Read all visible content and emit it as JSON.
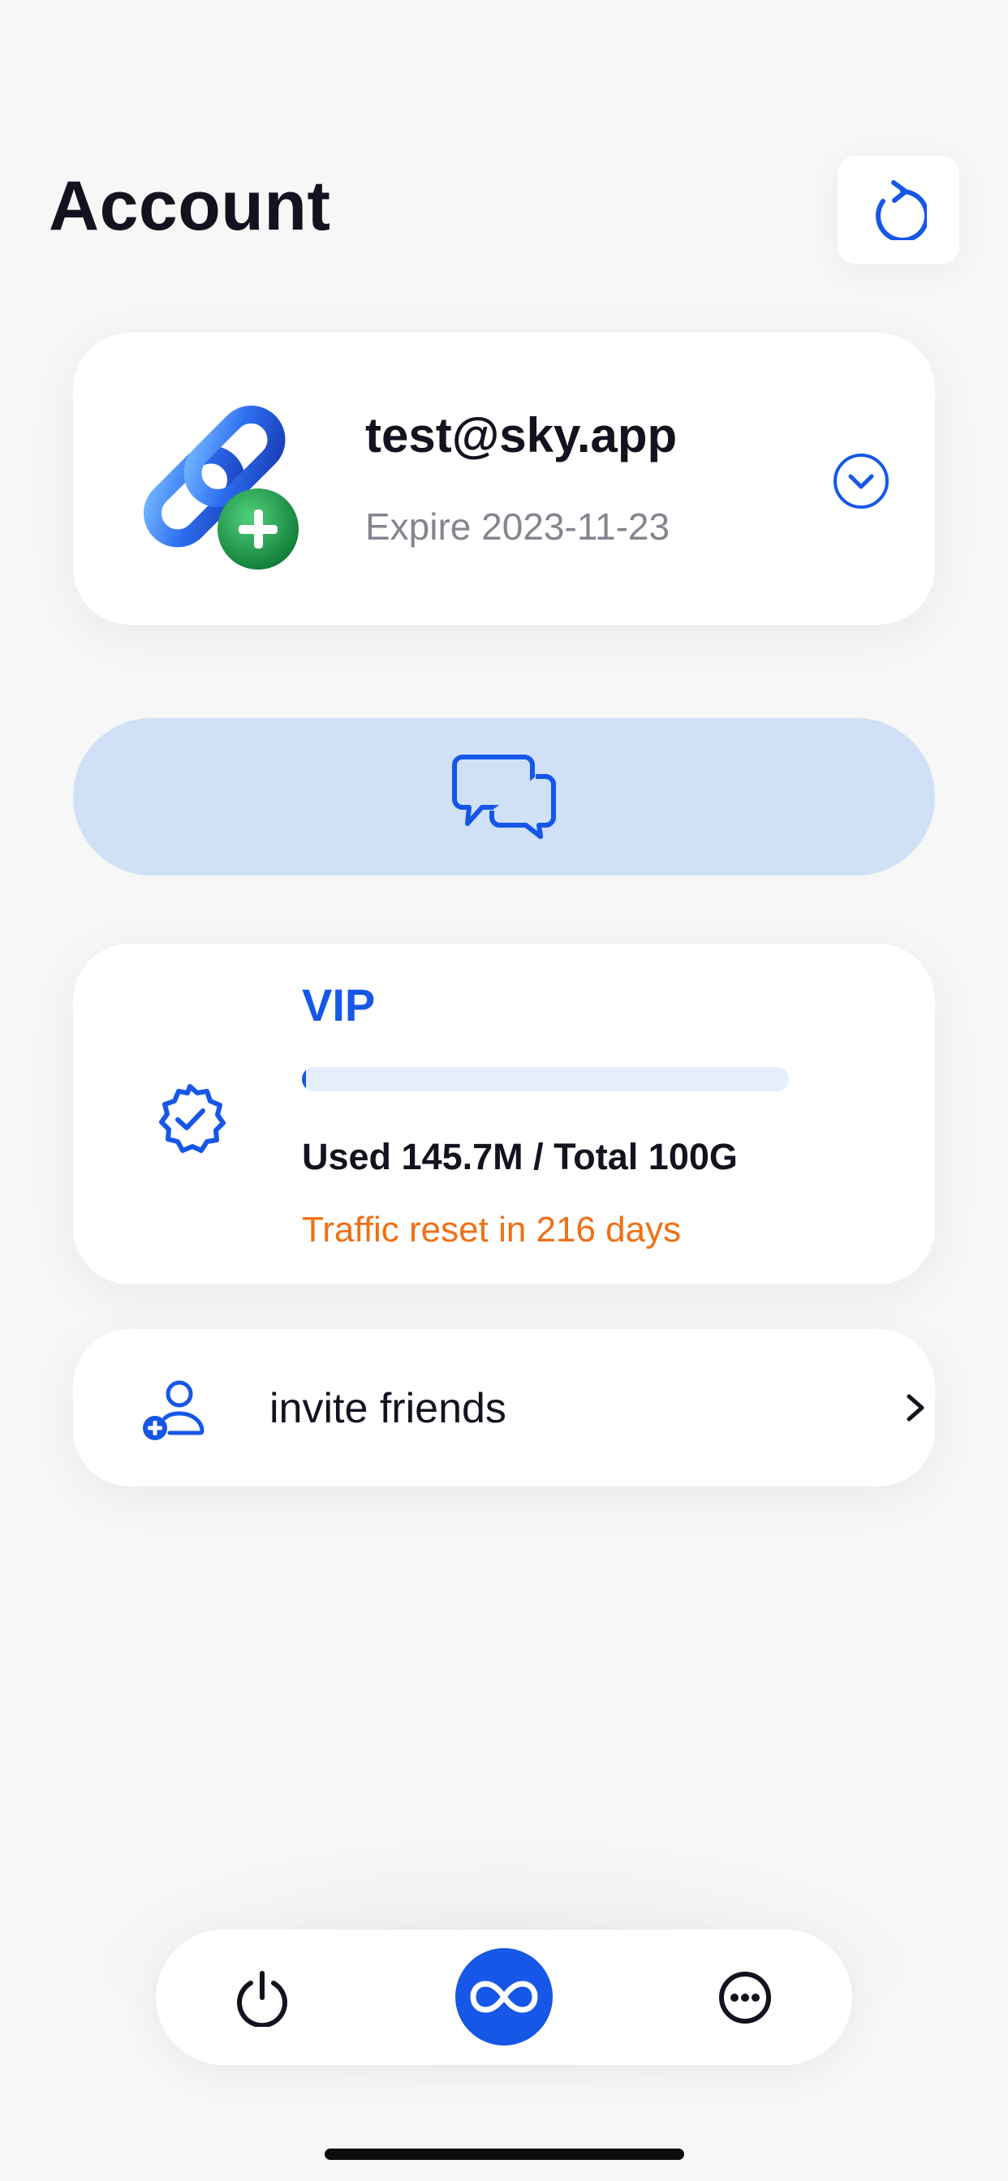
{
  "header": {
    "title": "Account",
    "refresh_icon": "refresh-icon"
  },
  "account": {
    "email": "test@sky.app",
    "expire": "Expire 2023-11-23",
    "avatar_icon": "link-add-icon",
    "expand_icon": "chevron-down-circle-icon"
  },
  "support": {
    "icon": "chat-bubbles-icon"
  },
  "vip": {
    "title": "VIP",
    "usage": "Used 145.7M / Total 100G",
    "progress_fraction": 0.0014,
    "reset": "Traffic reset in 216 days",
    "badge_icon": "verified-badge-icon"
  },
  "invite": {
    "label": "invite friends",
    "icon": "person-add-icon",
    "chevron_icon": "chevron-right-icon"
  },
  "nav": {
    "items": [
      {
        "name": "power",
        "icon": "power-icon"
      },
      {
        "name": "plans",
        "icon": "infinity-icon"
      },
      {
        "name": "more",
        "icon": "more-icon"
      }
    ]
  },
  "colors": {
    "accent": "#1657e8",
    "chat_bg": "#cfe0f7",
    "warning": "#f07015",
    "text": "#13131f",
    "muted": "#85858f",
    "background": "#f7f7f8"
  }
}
